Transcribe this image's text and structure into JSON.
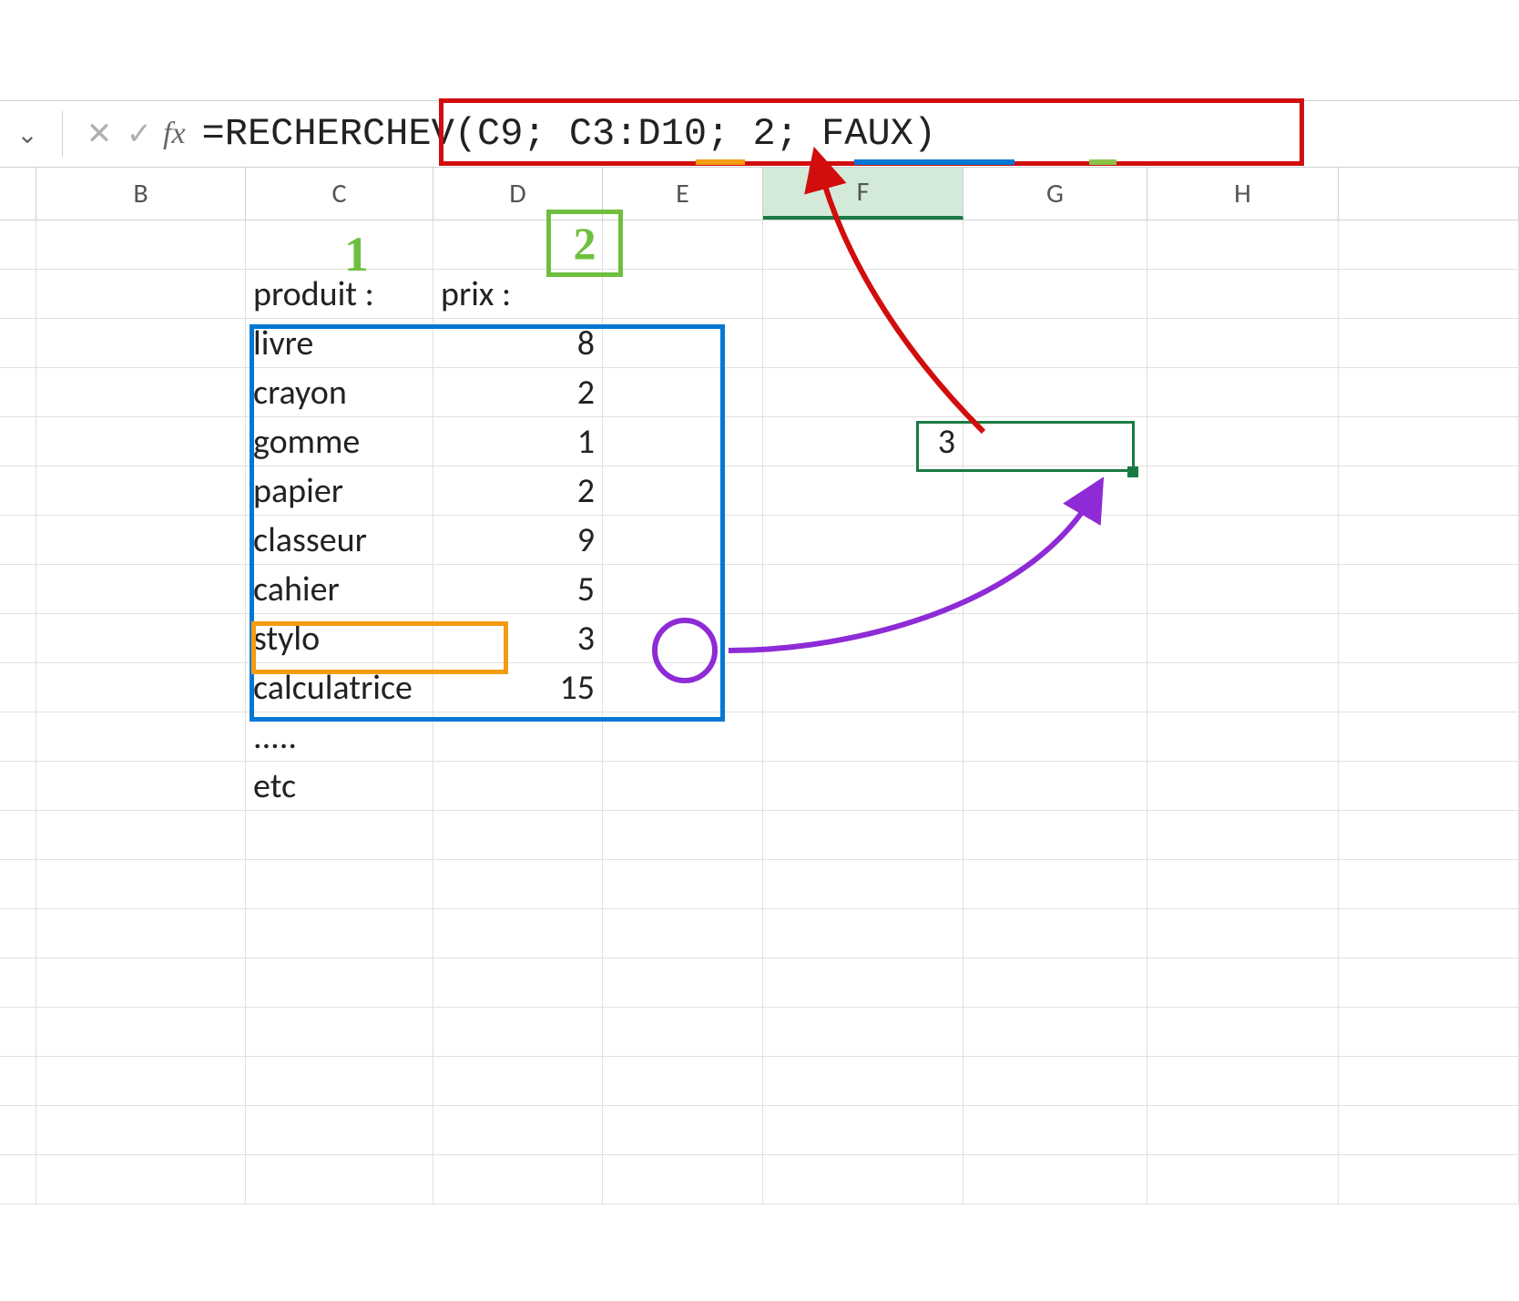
{
  "formula_bar": {
    "fx_label": "fx",
    "formula": "=RECHERCHEV(C9; C3:D10; 2; FAUX)"
  },
  "columns": [
    "B",
    "C",
    "D",
    "E",
    "F",
    "G",
    "H"
  ],
  "active_column": "F",
  "headers": {
    "product": "produit :",
    "price": "prix :"
  },
  "table": [
    {
      "product": "livre",
      "price": 8
    },
    {
      "product": "crayon",
      "price": 2
    },
    {
      "product": "gomme",
      "price": 1
    },
    {
      "product": "papier",
      "price": 2
    },
    {
      "product": "classeur",
      "price": 9
    },
    {
      "product": "cahier",
      "price": 5
    },
    {
      "product": "stylo",
      "price": 3
    },
    {
      "product": "calculatrice",
      "price": 15
    }
  ],
  "trailing": {
    "dots": ".....",
    "etc": "etc"
  },
  "result_cell": {
    "value": 3
  },
  "annotations": {
    "col_index_1": "1",
    "col_index_2": "2",
    "colors": {
      "formula_box": "#d10d0d",
      "lookup_value": "#f39c12",
      "table_array": "#0078d4",
      "col_index": "#6fbf3f",
      "result_arrow": "#8e2bd6",
      "formula_arrow": "#d10d0d"
    }
  }
}
